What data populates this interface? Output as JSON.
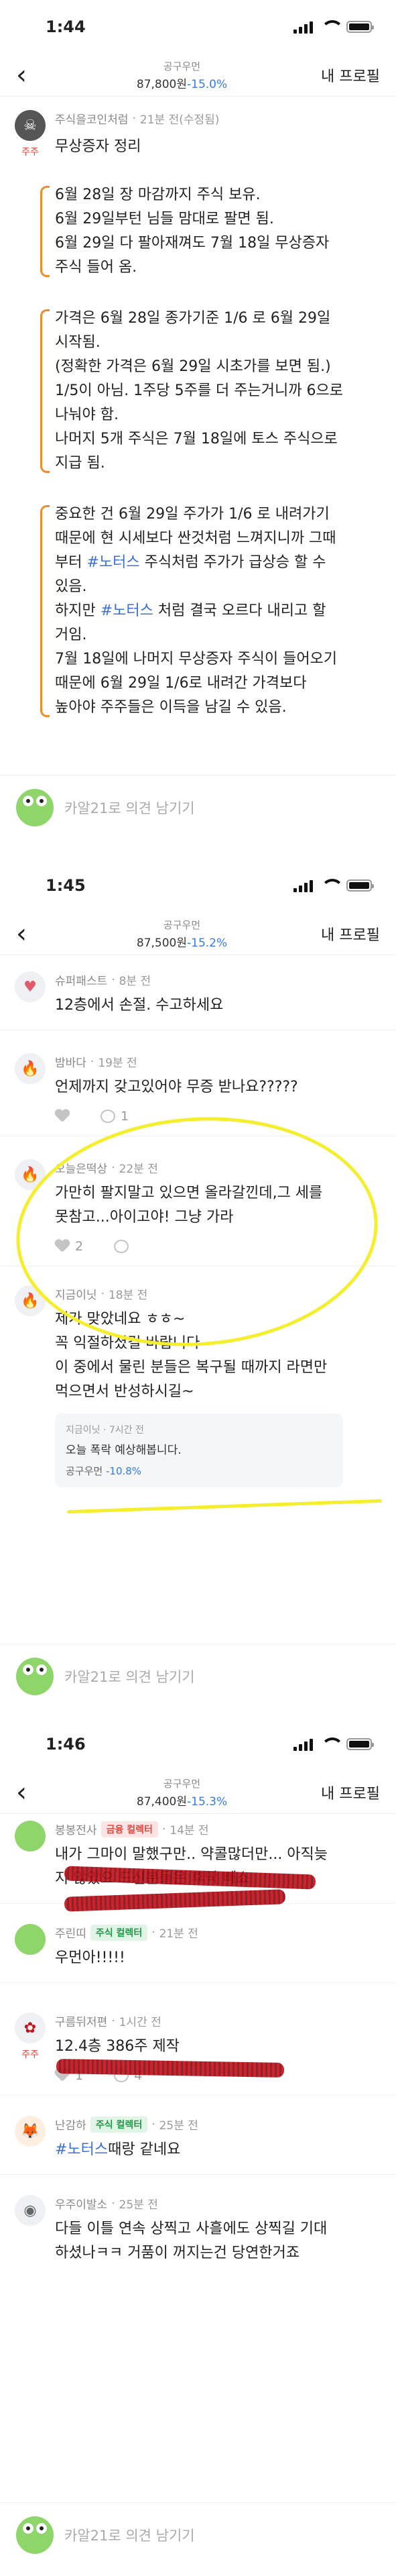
{
  "screens": [
    {
      "time": "1:44",
      "stock": {
        "name": "공구우먼",
        "price": "87,800원",
        "change": "-15.0%"
      },
      "profile_label": "내 프로필",
      "post": {
        "author": "주식을코인처럼",
        "time": "21분 전(수정됨)",
        "badge": "주주",
        "title": "무상증자 정리",
        "p1": [
          "6월 28일 장 마감까지 주식 보유.",
          "6월 29일부턴 님들 맘대로 팔면 됨.",
          "6월 29일 다 팔아재껴도 7월 18일 무상증자",
          "주식 들어 옴."
        ],
        "p2": [
          "가격은 6월 28일 종가기준 1/6 로 6월 29일",
          "시작됨.",
          "(정확한 가격은 6월 29일 시초가를 보면 됨.)",
          "1/5이 아님. 1주당 5주를 더 주는거니까 6으로",
          "나눠야 함.",
          "나머지 5개 주식은 7월 18일에 토스 주식으로",
          "지급 됨."
        ],
        "p3a": "중요한 건 6월 29일 주가가 1/6 로 내려가기",
        "p3b": "때문에 현 시세보다 싼것처럼 느껴지니까 그때",
        "p3c_pre": "부터 ",
        "p3c_tag": "#노터스",
        "p3c_post": " 주식처럼 주가가 급상승 할 수",
        "p3d": "있음.",
        "p3e_pre": "하지만 ",
        "p3e_tag": "#노터스",
        "p3e_post": " 처럼 결국 오르다 내리고 할",
        "p3f": "거임.",
        "p3g": "7월 18일에 나머지 무상증자 주식이 들어오기",
        "p3h": "때문에 6월 29일 1/6로 내려간 가격보다",
        "p3i": "높아야 주주들은 이득을 남길 수 있음."
      },
      "input_placeholder": "카알21로 의견 남기기"
    },
    {
      "time": "1:45",
      "stock": {
        "name": "공구우먼",
        "price": "87,500원",
        "change": "-15.2%"
      },
      "profile_label": "내 프로필",
      "comments": [
        {
          "author": "슈퍼패스트",
          "time": "8분 전",
          "text": "12층에서 손절. 수고하세요"
        },
        {
          "author": "밤바다",
          "time": "19분 전",
          "text": "언제까지 갖고있어야 무증 받나요?????",
          "likes": "",
          "replies": "1"
        },
        {
          "author": "오늘은떡상",
          "time": "22분 전",
          "text1": "가만히 팔지말고 있으면 올라갈낀데,그 세를",
          "text2": "못참고...아이고야!  그냥 가라",
          "likes": "2",
          "replies": ""
        },
        {
          "author": "지금이닛",
          "time": "18분 전",
          "text1": "제가 맞았네요 ㅎㅎ~",
          "text2": "꼭 익절하셨길 바랍니다",
          "text3": "이 중에서 물린 분들은 복구될 때까지 라면만",
          "text4": "먹으면서 반성하시길~",
          "quote": {
            "user": "지금이닛 · 7시간 전",
            "text": "오늘 폭락 예상해봅니다.",
            "stock": "공구우먼",
            "change": "-10.8%"
          }
        }
      ],
      "input_placeholder": "카알21로 의견 남기기"
    },
    {
      "time": "1:46",
      "stock": {
        "name": "공구우먼",
        "price": "87,400원",
        "change": "-15.3%"
      },
      "profile_label": "내 프로필",
      "comments": [
        {
          "author": "봉봉전사",
          "badge": "금융 컬렉터",
          "time": "14분 전",
          "text1": "내가 그마이 말했구만.. 약콜많더만... 아직늦",
          "text2": "지 않았으 드신분들은 후딱 빼쇼"
        },
        {
          "author": "주린띠",
          "badge": "주식 컬렉터",
          "time": "21분 전",
          "text": "우먼아!!!!!"
        },
        {
          "author": "구름뒤저편",
          "time": "1시간 전",
          "text": "12.4층 386주 제작",
          "likes": "1",
          "replies": "4"
        },
        {
          "author": "난감하",
          "badge": "주식 컬렉터",
          "time": "25분 전",
          "tag": "#노터스",
          "text": "때랑 같네요"
        },
        {
          "author": "우주이발소",
          "time": "25분 전",
          "text1": "다들 이틀 연속 상찍고 사흘에도 상찍길 기대",
          "text2": "하셨나ㅋㅋ 거품이 꺼지는건 당연한거죠"
        }
      ],
      "input_placeholder": "카알21로 의견 남기기"
    }
  ],
  "colors": {
    "accent": "#3478f6",
    "hashtag": "#3b6fe0",
    "owner_badge": "#e8453c",
    "bracket": "#f08a2a",
    "marker": "#f5ee2c",
    "scribble": "#c4121c"
  },
  "icons": {
    "back": "chevron-left-icon",
    "like": "heart-icon",
    "reply": "bubble-icon",
    "avatar_default": "frog-icon"
  }
}
